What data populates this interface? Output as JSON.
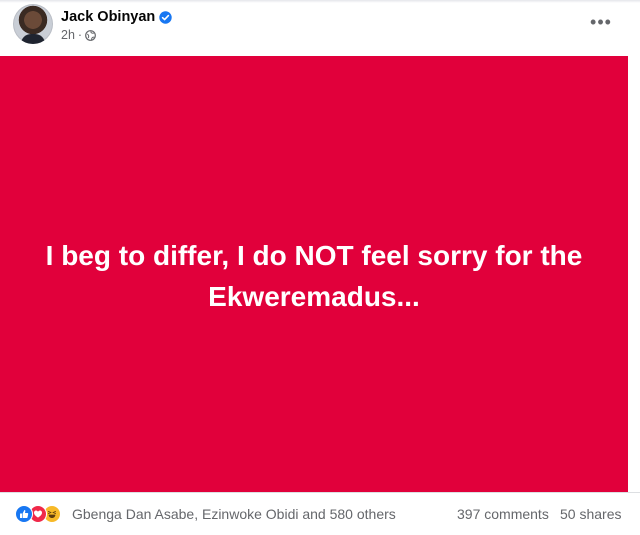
{
  "post": {
    "author": "Jack Obinyan",
    "time": "2h",
    "text": "I beg to differ, I do NOT feel sorry for the Ekweremadus...",
    "background_color": "#e1003b"
  },
  "icons": {
    "more": "more-options-icon",
    "verified": "verified-badge-icon",
    "audience": "globe-icon"
  },
  "engagement": {
    "reactions": [
      "like",
      "love",
      "haha"
    ],
    "reactors_text": "Gbenga Dan Asabe, Ezinwoke Obidi and 580 others",
    "comments": "397 comments",
    "shares": "50 shares"
  }
}
